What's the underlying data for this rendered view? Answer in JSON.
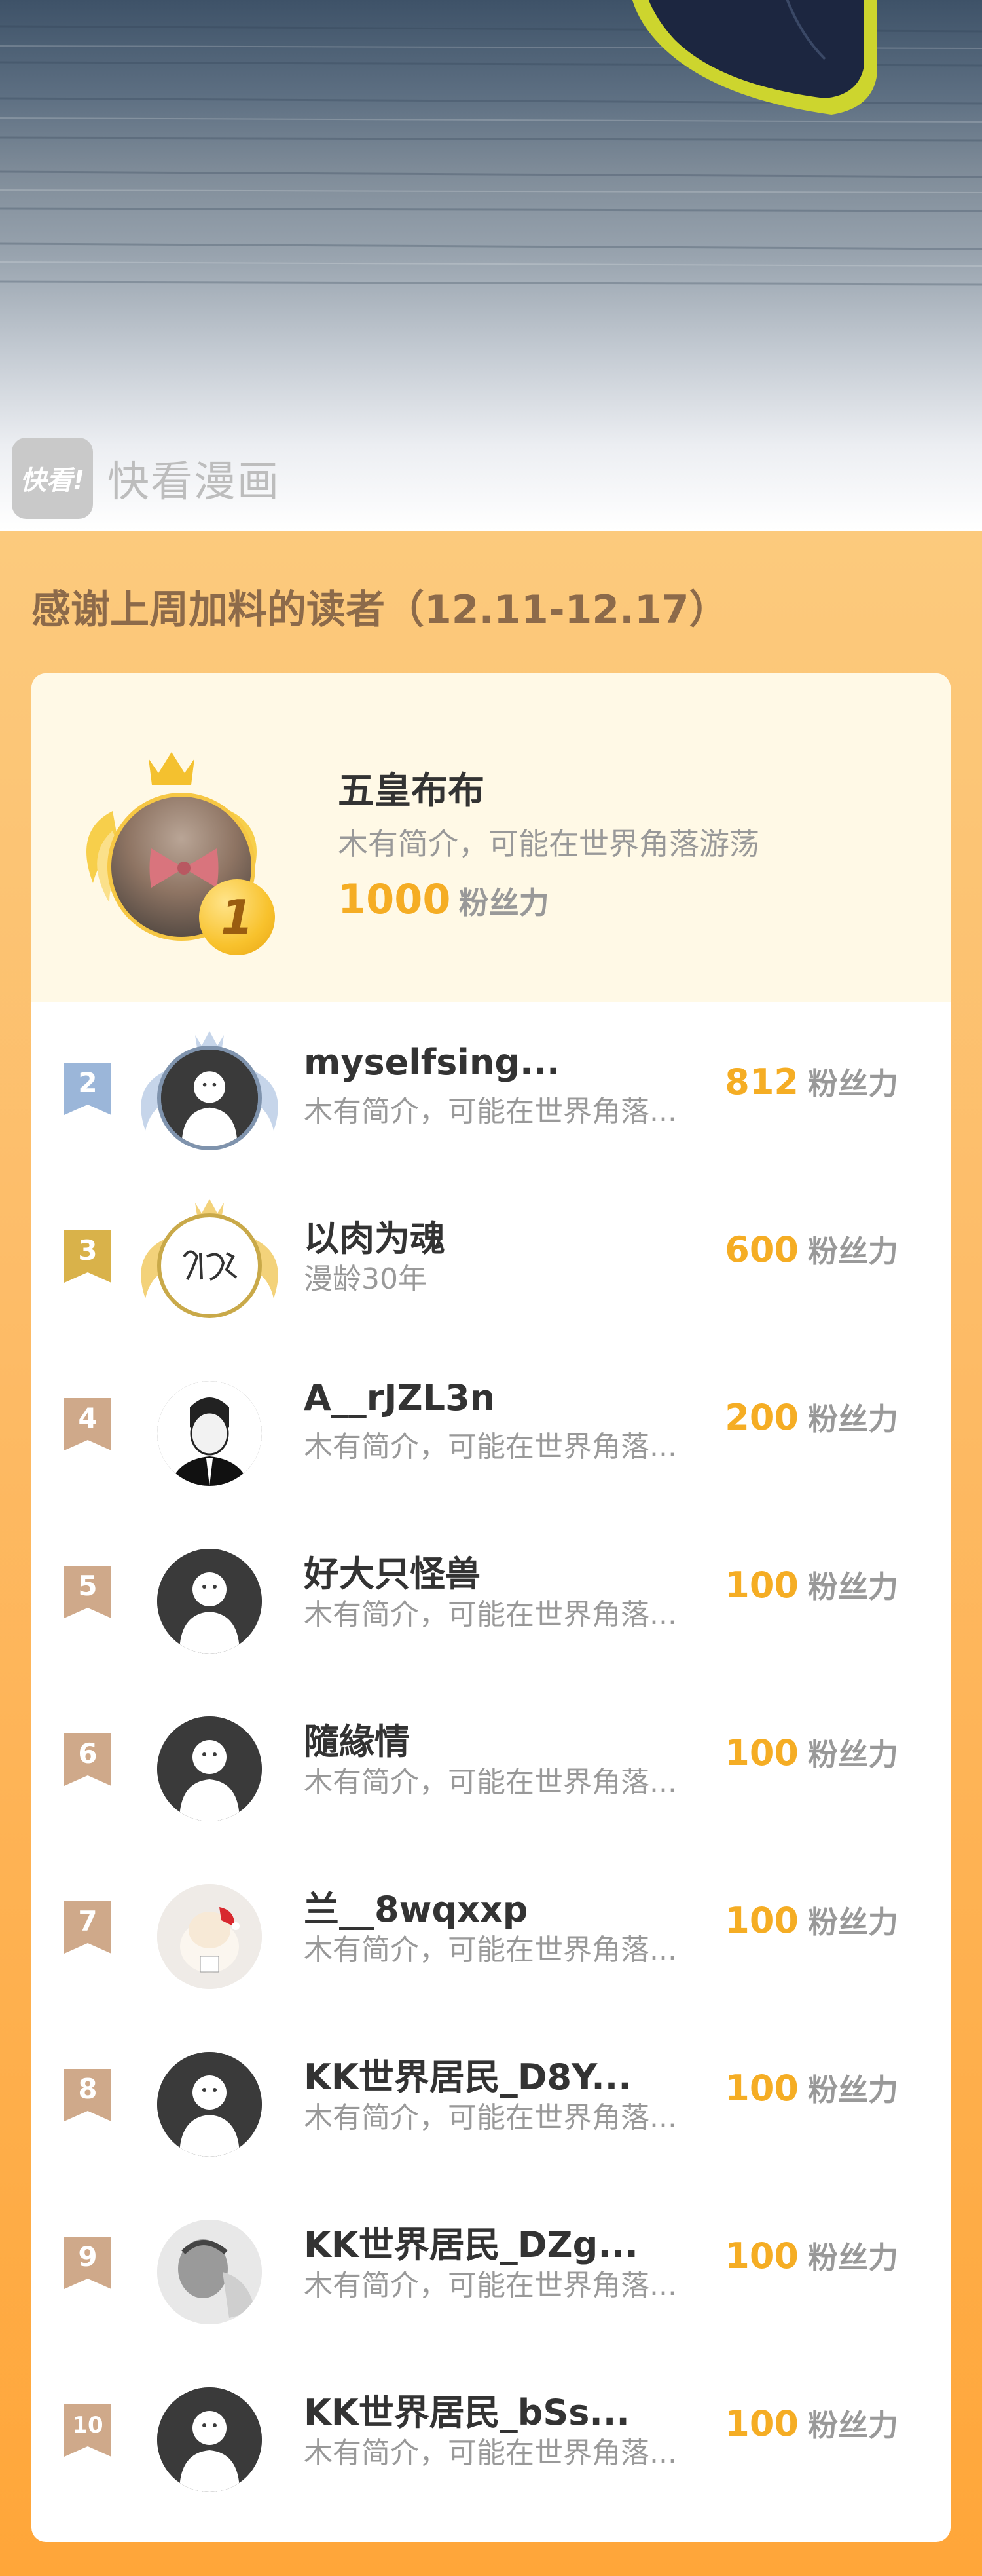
{
  "colors": {
    "accent": "#f5ad24",
    "rank2": "#9bb6d9",
    "rank3": "#d9b24a",
    "rankOther": "#cfa98a"
  },
  "watermark": {
    "logo_text": "快看!",
    "text": "快看漫画"
  },
  "section_title": "感谢上周加料的读者（12.11-12.17）",
  "unit_label": "粉丝力",
  "top1": {
    "rank": "1",
    "name": "五皇布布",
    "bio": "木有简介，可能在世界角落游荡",
    "score": "1000",
    "unit": "粉丝力"
  },
  "rows": [
    {
      "rank": "2",
      "name": "myselfsing...",
      "bio": "木有简介，可能在世界角落...",
      "score": "812",
      "unit": "粉丝力"
    },
    {
      "rank": "3",
      "name": "以肉为魂",
      "bio": "漫龄30年",
      "score": "600",
      "unit": "粉丝力"
    },
    {
      "rank": "4",
      "name": "A__rJZL3n",
      "bio": "木有简介，可能在世界角落...",
      "score": "200",
      "unit": "粉丝力"
    },
    {
      "rank": "5",
      "name": "好大只怪兽",
      "bio": "木有简介，可能在世界角落...",
      "score": "100",
      "unit": "粉丝力"
    },
    {
      "rank": "6",
      "name": "隨緣情",
      "bio": "木有简介，可能在世界角落...",
      "score": "100",
      "unit": "粉丝力"
    },
    {
      "rank": "7",
      "name": "兰__8wqxxp",
      "bio": "木有简介，可能在世界角落...",
      "score": "100",
      "unit": "粉丝力"
    },
    {
      "rank": "8",
      "name": "KK世界居民_D8Y...",
      "bio": "木有简介，可能在世界角落...",
      "score": "100",
      "unit": "粉丝力"
    },
    {
      "rank": "9",
      "name": "KK世界居民_DZg...",
      "bio": "木有简介，可能在世界角落...",
      "score": "100",
      "unit": "粉丝力"
    },
    {
      "rank": "10",
      "name": "KK世界居民_bSs...",
      "bio": "木有简介，可能在世界角落...",
      "score": "100",
      "unit": "粉丝力"
    }
  ]
}
